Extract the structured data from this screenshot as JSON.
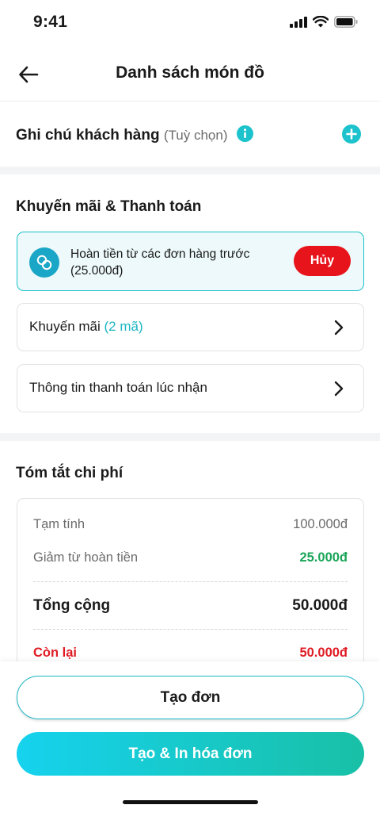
{
  "status": {
    "time": "9:41"
  },
  "nav": {
    "title": "Danh sách món đồ"
  },
  "note": {
    "title": "Ghi chú khách hàng",
    "optional": "(Tuỳ chọn)"
  },
  "promo": {
    "section_title": "Khuyến mãi & Thanh toán",
    "refund_text": "Hoàn tiền từ các đơn hàng trước (25.000đ)",
    "cancel_label": "Hủy",
    "promotions_label": "Khuyến mãi",
    "promotions_count": "(2 mã)",
    "payment_label": "Thông tin thanh toán lúc nhận"
  },
  "summary": {
    "title": "Tóm tắt chi phí",
    "subtotal_label": "Tạm tính",
    "subtotal_value": "100.000đ",
    "refund_discount_label": "Giảm từ hoàn tiền",
    "refund_discount_value": "25.000đ",
    "total_label": "Tổng cộng",
    "total_value": "50.000đ",
    "remaining_label": "Còn lại",
    "remaining_value": "50.000đ"
  },
  "actions": {
    "create_label": "Tạo đơn",
    "create_print_label": "Tạo & In hóa đơn"
  },
  "colors": {
    "accent": "#1cc2cc",
    "cancel": "#e8141c",
    "green": "#1aa558",
    "red": "#e01b24"
  }
}
